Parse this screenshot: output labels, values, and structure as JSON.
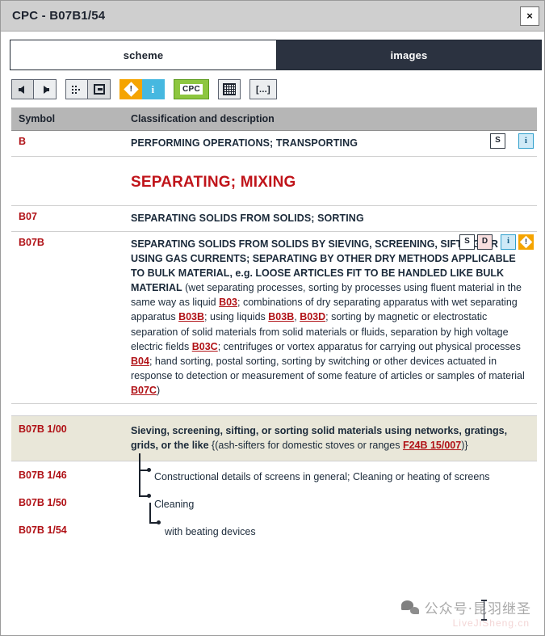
{
  "window": {
    "title": "CPC - B07B1/54",
    "close_label": "×"
  },
  "tabs": [
    {
      "label": "scheme",
      "active": true
    },
    {
      "label": "images",
      "active": false
    }
  ],
  "toolbar": {
    "buttons": [
      {
        "name": "back-button",
        "icon": "arrow-left-icon",
        "label": ""
      },
      {
        "name": "forward-button",
        "icon": "arrow-right-icon",
        "label": ""
      },
      {
        "name": "hierarchy-button",
        "icon": "dots-hierarchy-icon",
        "label": ""
      },
      {
        "name": "layout-button",
        "icon": "window-layout-icon",
        "label": ""
      },
      {
        "name": "warning-button",
        "icon": "warning-diamond-icon",
        "label": "!"
      },
      {
        "name": "info-button",
        "icon": "info-icon",
        "label": "i"
      },
      {
        "name": "cpc-button",
        "icon": "cpc-icon",
        "label": "CPC"
      },
      {
        "name": "grid-button",
        "icon": "grid-icon",
        "label": ""
      },
      {
        "name": "more-button",
        "icon": "ellipsis-icon",
        "label": "[...]"
      }
    ]
  },
  "table": {
    "headers": {
      "symbol": "Symbol",
      "description": "Classification and description"
    },
    "rows": [
      {
        "symbol": "B",
        "text": "PERFORMING OPERATIONS; TRANSPORTING",
        "icons": [
          "s",
          "i"
        ]
      },
      {
        "symbol": "",
        "title": "SEPARATING; MIXING"
      },
      {
        "symbol": "B07",
        "text": "SEPARATING SOLIDS FROM SOLIDS; SORTING"
      },
      {
        "symbol": "B07B",
        "icons": [
          "s",
          "d",
          "i",
          "warn"
        ],
        "caps": "SEPARATING SOLIDS FROM SOLIDS BY SIEVING, SCREENING, SIFTING OR BY USING GAS CURRENTS; SEPARATING BY OTHER DRY METHODS APPLICABLE TO BULK MATERIAL, e.g. LOOSE ARTICLES FIT TO BE HANDLED LIKE BULK MATERIAL",
        "note_open": " (wet separating processes, sorting by processes using fluent material in the same way as liquid ",
        "l1": "B03",
        "n1": "; combinations of dry separating apparatus with wet separating apparatus ",
        "l2": "B03B",
        "n2": "; using liquids ",
        "l3": "B03B",
        "n3": ", ",
        "l4": "B03D",
        "n4": "; sorting by magnetic or electrostatic separation of solid materials from solid materials or fluids, separation by high voltage electric fields ",
        "l5": "B03C",
        "n5": "; centrifuges or vortex apparatus for carrying out physical processes ",
        "l6": "B04",
        "n6": "; hand sorting, postal sorting, sorting by switching or other devices actuated in response to detection or measurement of some feature of articles or samples of material ",
        "l7": "B07C",
        "n7": ")"
      },
      {
        "symbol": "B07B 1/00",
        "highlighted": true,
        "bold": "Sieving, screening, sifting, or sorting solid materials using networks, gratings, grids, or the like",
        "n1": " {(ash-sifters for domestic stoves or ranges ",
        "l1": "F24B 15/007",
        "n2": ")}"
      },
      {
        "symbol": "B07B 1/46",
        "text": "Constructional details of screens in general; Cleaning or heating of screens"
      },
      {
        "symbol": "B07B 1/50",
        "text": "Cleaning"
      },
      {
        "symbol": "B07B 1/54",
        "text": "with beating devices"
      }
    ]
  },
  "watermark": {
    "text": "公众号·昆羽继圣",
    "subtext": "LiveJiSheng.cn"
  },
  "colors": {
    "accent_red": "#b01116",
    "title_red": "#c0141a",
    "tab_dark": "#2b3240",
    "header_gray": "#b6b6b6",
    "highlight_beige": "#e9e7d9",
    "warn_yellow": "#f5a400",
    "info_cyan": "#46b8e0",
    "cpc_green": "#8dc63f"
  }
}
